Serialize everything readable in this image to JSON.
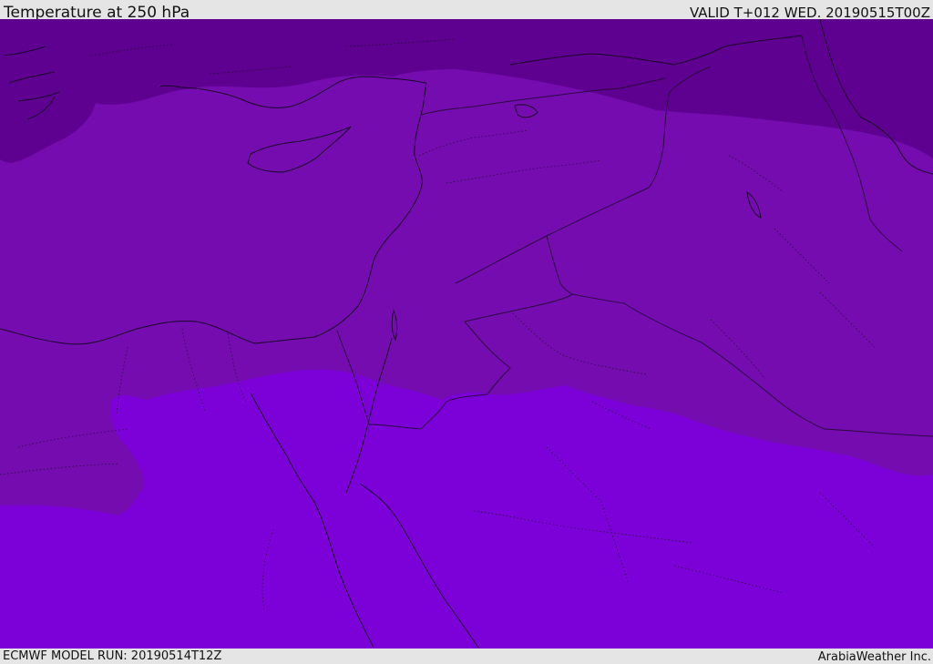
{
  "header": {
    "title": "Temperature at 250 hPa",
    "valid_time": "VALID T+012 WED. 20190515T00Z"
  },
  "footer": {
    "model_run": "ECMWF MODEL RUN: 20190514T12Z",
    "credit": "ArabiaWeather Inc."
  },
  "map": {
    "colors": {
      "band_cold": "#5e0090",
      "band_mid": "#740cb0",
      "band_warm": "#7c00d8",
      "coastline": "#1a0628",
      "border": "#2a0a40"
    }
  }
}
